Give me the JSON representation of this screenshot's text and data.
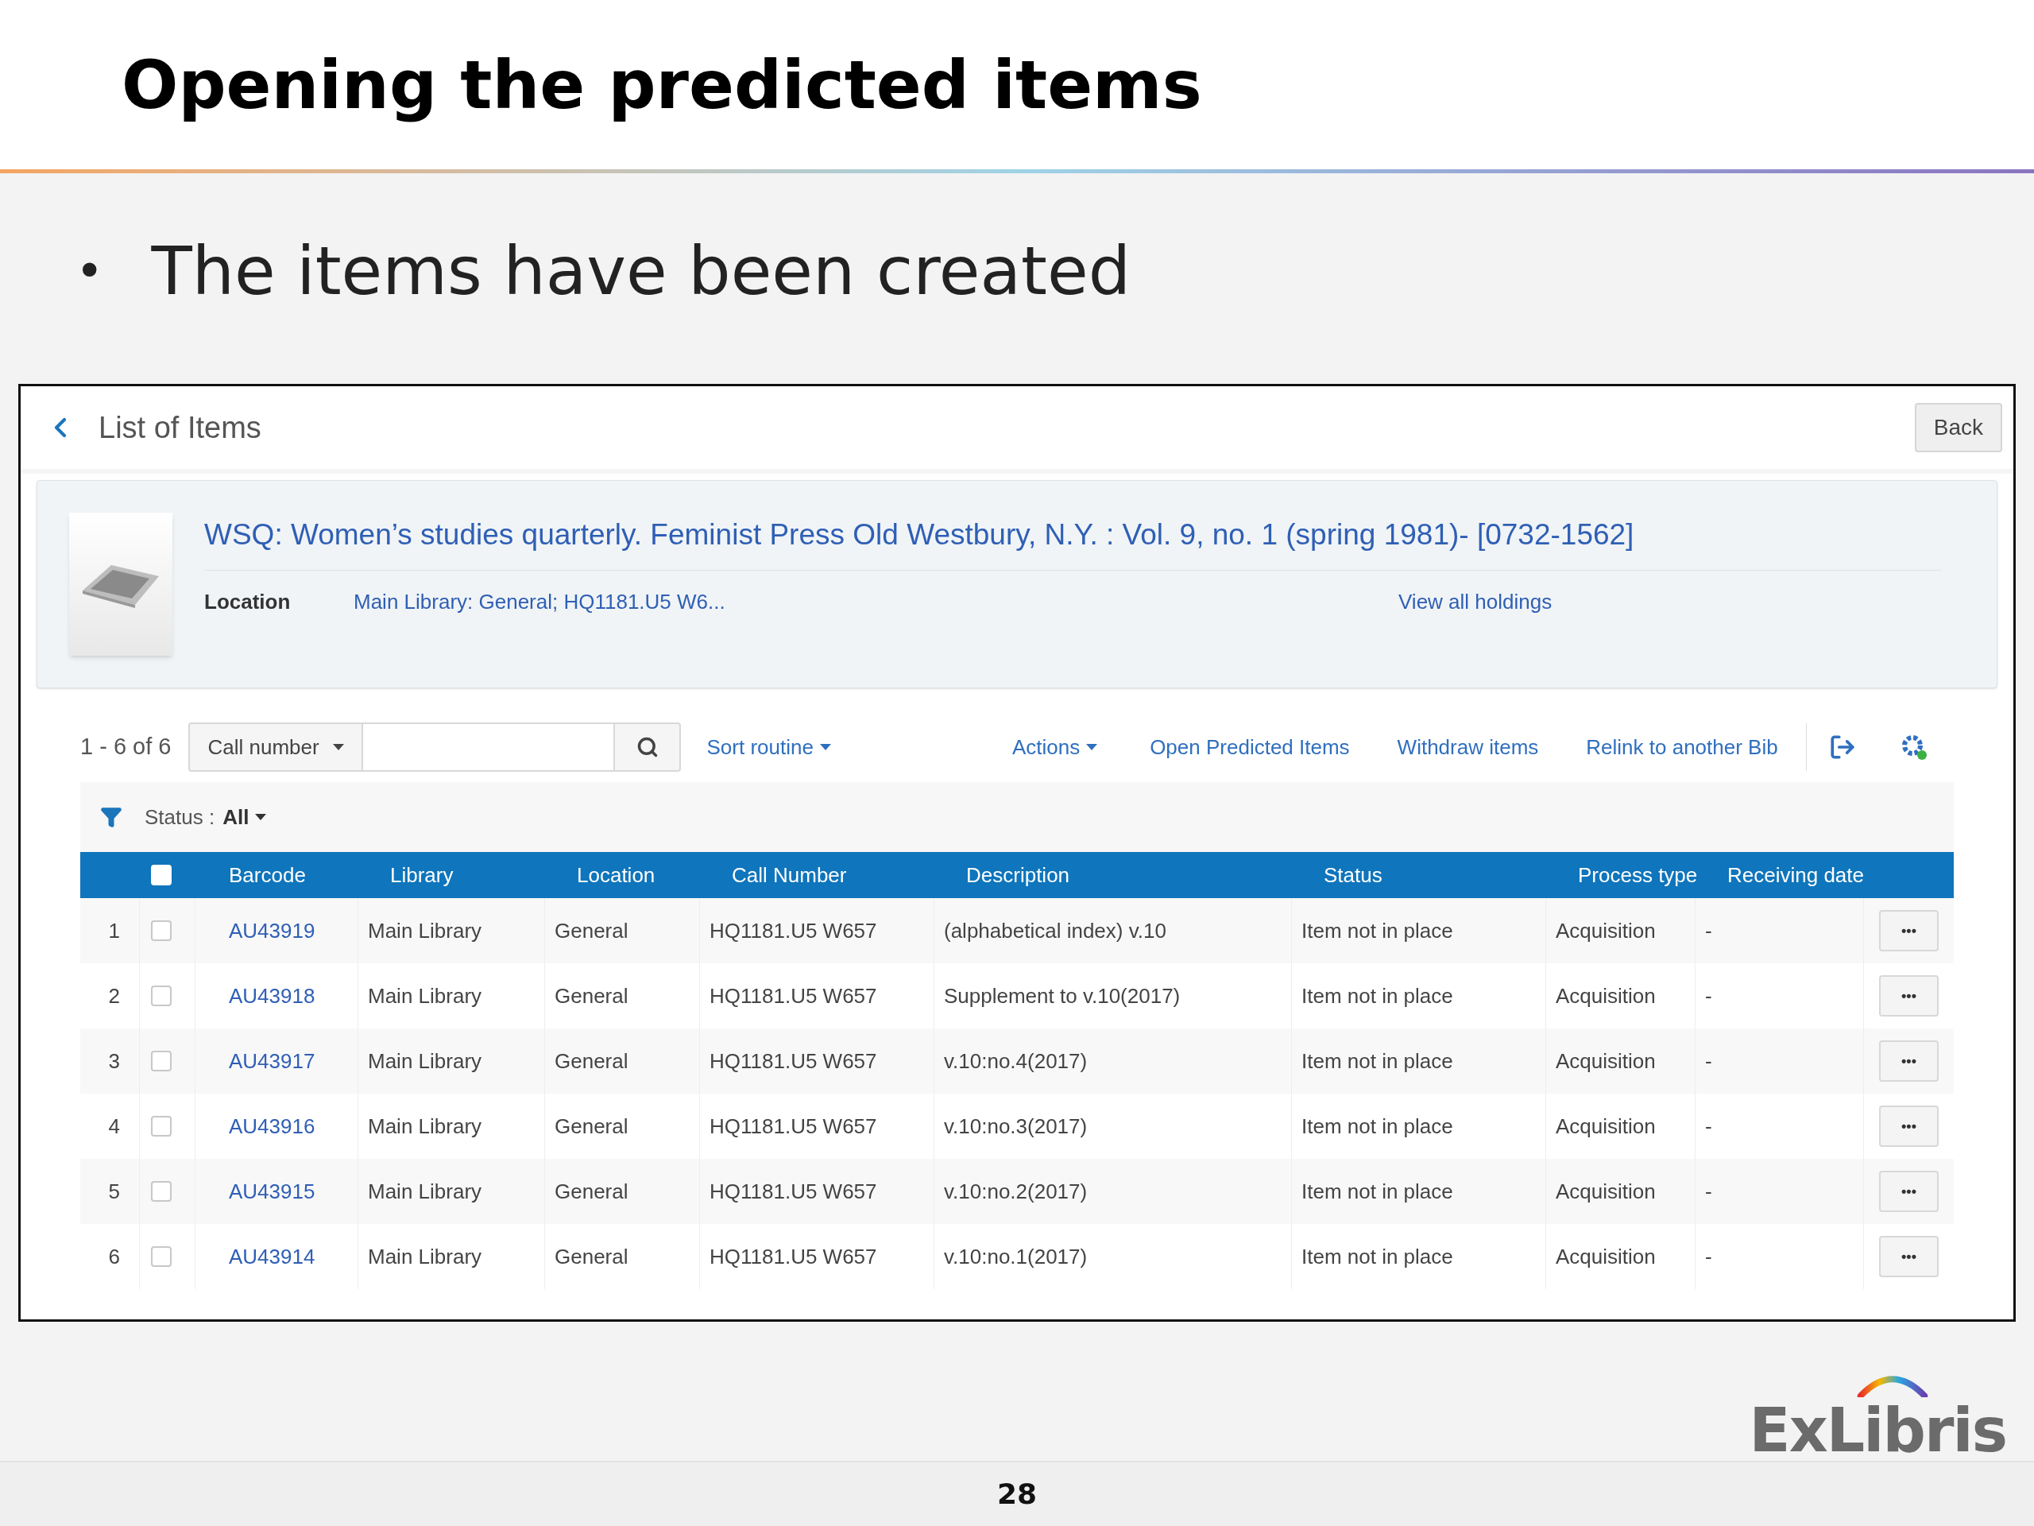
{
  "slide": {
    "title": "Opening the predicted items",
    "bullet": "The items have been created",
    "bullet_mark": "•",
    "logo": "ExLibris",
    "page_number": "28"
  },
  "window": {
    "title": "List of Items",
    "back_button": "Back"
  },
  "record": {
    "title": "WSQ: Women’s studies quarterly. Feminist Press Old Westbury, N.Y. : Vol. 9, no. 1 (spring 1981)- [0732-1562]",
    "location_label": "Location",
    "location_value": "Main Library: General; HQ1181.U5 W6...",
    "holdings_link": "View all holdings"
  },
  "toolbar": {
    "count": "1 - 6 of 6",
    "search_scope": "Call number",
    "actions": [
      {
        "label": "Sort routine",
        "kind": "dropdown"
      },
      {
        "label": "Actions",
        "kind": "dropdown"
      },
      {
        "label": "Open Predicted Items",
        "kind": "link"
      },
      {
        "label": "Withdraw items",
        "kind": "link"
      },
      {
        "label": "Relink to another Bib",
        "kind": "link"
      }
    ]
  },
  "filter": {
    "label": "Status :",
    "value": "All"
  },
  "table": {
    "select_all_checked": false,
    "columns": [
      "Barcode",
      "Library",
      "Location",
      "Call Number",
      "Description",
      "Status",
      "Process type",
      "Receiving date"
    ],
    "rows": [
      {
        "number": "1",
        "checked": false,
        "cells": [
          "AU43919",
          "Main Library",
          "General",
          "HQ1181.U5 W657",
          "(alphabetical index) v.10",
          "Item not in place",
          "Acquisition",
          "-"
        ],
        "menu": "•••"
      },
      {
        "number": "2",
        "checked": false,
        "cells": [
          "AU43918",
          "Main Library",
          "General",
          "HQ1181.U5 W657",
          "Supplement to v.10(2017)",
          "Item not in place",
          "Acquisition",
          "-"
        ],
        "menu": "•••"
      },
      {
        "number": "3",
        "checked": false,
        "cells": [
          "AU43917",
          "Main Library",
          "General",
          "HQ1181.U5 W657",
          "v.10:no.4(2017)",
          "Item not in place",
          "Acquisition",
          "-"
        ],
        "menu": "•••"
      },
      {
        "number": "4",
        "checked": false,
        "cells": [
          "AU43916",
          "Main Library",
          "General",
          "HQ1181.U5 W657",
          "v.10:no.3(2017)",
          "Item not in place",
          "Acquisition",
          "-"
        ],
        "menu": "•••"
      },
      {
        "number": "5",
        "checked": false,
        "cells": [
          "AU43915",
          "Main Library",
          "General",
          "HQ1181.U5 W657",
          "v.10:no.2(2017)",
          "Item not in place",
          "Acquisition",
          "-"
        ],
        "menu": "•••"
      },
      {
        "number": "6",
        "checked": false,
        "cells": [
          "AU43914",
          "Main Library",
          "General",
          "HQ1181.U5 W657",
          "v.10:no.1(2017)",
          "Item not in place",
          "Acquisition",
          "-"
        ],
        "menu": "•••"
      }
    ]
  }
}
